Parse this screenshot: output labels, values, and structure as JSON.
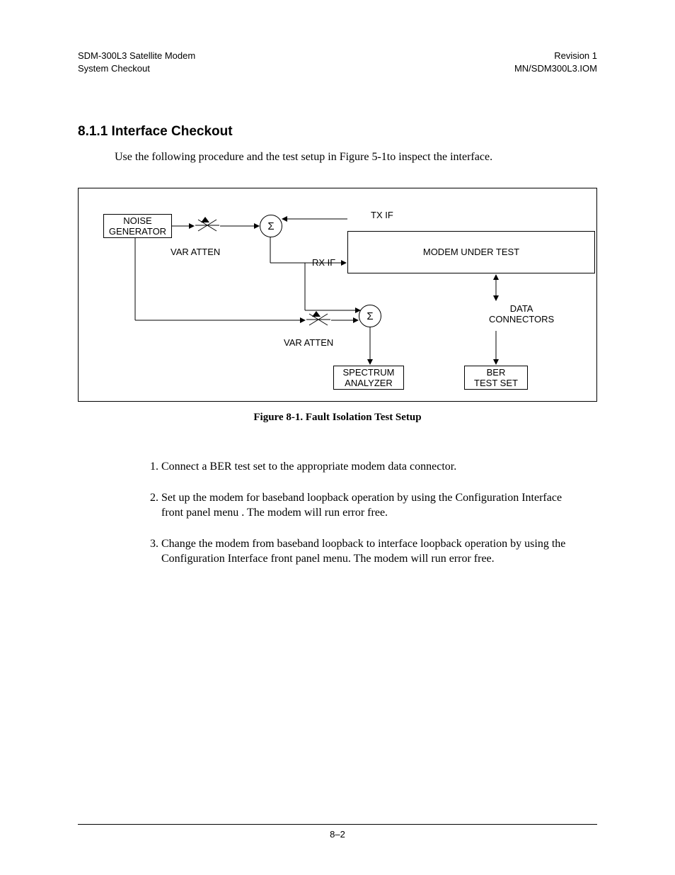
{
  "header": {
    "left_line1": "SDM-300L3 Satellite Modem",
    "left_line2": "System Checkout",
    "right_line1": "Revision 1",
    "right_line2": "MN/SDM300L3.IOM"
  },
  "section": {
    "heading": "8.1.1  Interface Checkout",
    "intro": "Use the following procedure and the test setup in Figure 5-1to inspect the interface."
  },
  "diagram": {
    "noise_generator": "NOISE\nGENERATOR",
    "var_atten_top": "VAR ATTEN",
    "var_atten_bottom": "VAR ATTEN",
    "tx_if": "TX IF",
    "rx_if": "RX IF",
    "modem": "MODEM UNDER TEST",
    "data_connectors": "DATA\nCONNECTORS",
    "spectrum_analyzer": "SPECTRUM\nANALYZER",
    "ber_test_set": "BER\nTEST SET",
    "sigma": "Σ"
  },
  "caption": "Figure 8-1.  Fault Isolation Test Setup",
  "steps": [
    "Connect a BER test set to the appropriate modem data connector.",
    "Set up the modem for baseband loopback operation by using the Configuration Interface front panel menu . The modem will run error free.",
    "Change the modem from baseband loopback to interface loopback operation by using the Configuration Interface front panel menu. The modem will run error free."
  ],
  "footer": {
    "page": "8–2"
  }
}
